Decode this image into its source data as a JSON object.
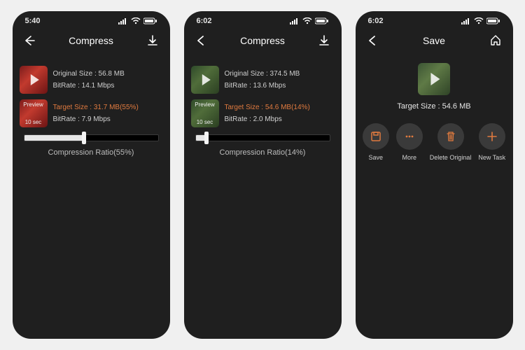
{
  "screens": [
    {
      "status_time": "5:40",
      "nav_title": "Compress",
      "thumb_style": "red",
      "original_size_line": "Original Size : 56.8 MB",
      "original_bitrate_line": "BitRate : 14.1 Mbps",
      "target_size_line": "Target Size : 31.7 MB(55%)",
      "target_bitrate_line": "BitRate : 7.9 Mbps",
      "preview_label": "Preview",
      "preview_seconds": "10 sec",
      "ratio_label": "Compression Ratio(55%)",
      "slider_percent": 45
    },
    {
      "status_time": "6:02",
      "nav_title": "Compress",
      "thumb_style": "green",
      "original_size_line": "Original Size : 374.5 MB",
      "original_bitrate_line": "BitRate : 13.6 Mbps",
      "target_size_line": "Target Size : 54.6 MB(14%)",
      "target_bitrate_line": "BitRate : 2.0 Mbps",
      "preview_label": "Preview",
      "preview_seconds": "10 sec",
      "ratio_label": "Compression Ratio(14%)",
      "slider_percent": 8
    },
    {
      "status_time": "6:02",
      "nav_title": "Save",
      "thumb_style": "green",
      "target_size_line": "Target Size : 54.6 MB",
      "actions": {
        "save": "Save",
        "more": "More",
        "delete": "Delete Original",
        "newtask": "New Task"
      }
    }
  ],
  "colors": {
    "accent": "#e07a3f"
  }
}
